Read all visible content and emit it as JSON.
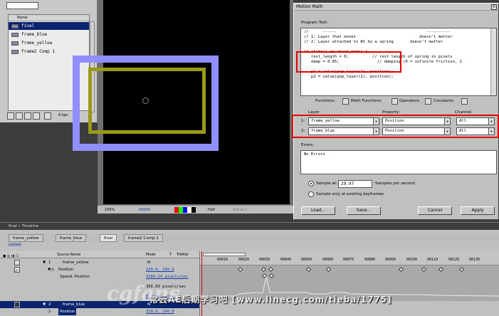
{
  "project": {
    "column_name": "Name",
    "items": [
      {
        "label": "final"
      },
      {
        "label": "frame_blue"
      },
      {
        "label": "frame_yellow"
      },
      {
        "label": "frame2 Comp 1"
      }
    ],
    "bpc": "8 bpc"
  },
  "viewer": {
    "zoom": "100%",
    "timecode": "00000",
    "resolution": "Half",
    "camera": "Active C..."
  },
  "dialog": {
    "title": "Motion Math",
    "program_text_label": "Program Text:",
    "code_lines": [
      "//      ------                                      ----------",
      "// 1: Layer that moves                           doesn't matter",
      "// 2: Layer attached to #1 by a spring       doesn't matter",
      "",
      "if (time() == start_time) {",
      "   rest_length = 0;          // rest length of spring in pixels",
      "   damp = 0.85;                // damping (0 = infinite friction, 1",
      "",
      "   p1 = value(pop_layer(1), position);",
      "   p2 = value(pop_layer(2), position);"
    ],
    "menus": {
      "functions": "Functions:",
      "math_functions": "Math Functions:",
      "operators": "Operators:",
      "constants": "Constants:"
    },
    "columns": {
      "layer": "Layer:",
      "property": "Property:",
      "channel": "Channel:"
    },
    "rows": [
      {
        "index": "1:",
        "layer": "frame_yellow",
        "property": "Position",
        "channel": "All"
      },
      {
        "index": "2:",
        "layer": "frame_blue",
        "property": "Position",
        "channel": "All"
      }
    ],
    "errors_label": "Errors:",
    "errors_text": "No Errors",
    "sample_at_label": "Sample at:",
    "sample_rate": "29.97",
    "samples_per_second": "Samples per second",
    "sample_keyframes": "Sample only at existing keyframes",
    "buttons": {
      "load": "Load...",
      "save": "Save...",
      "cancel": "Cancel",
      "apply": "Apply"
    }
  },
  "timeline": {
    "title": "final • Timeline",
    "tabs": [
      "frame_yellow",
      "frame_blue",
      "final",
      "frame2 Comp 1"
    ],
    "current_time": "00000",
    "columns": {
      "source_name": "Source Name",
      "mode": "Mode",
      "t": "T",
      "trkmat": "TrkMat"
    },
    "rows": {
      "layer1_index": "1",
      "layer1_name": "frame_yellow",
      "layer1_mode": "N",
      "position_label": "Position",
      "position_value": "320.0, 240.0",
      "speed_label": "Speed: Position",
      "speed_value": "3269.24 pixels/sec",
      "speed_max": "356.03 pixels/sec",
      "speed_min": "0.00 pixels/sec",
      "layer2_index": "2",
      "layer2_name": "frame_blue",
      "layer2_mode": "N",
      "position2_label": "Position",
      "position2_value": "320.0, 240.0"
    },
    "ruler_ticks": [
      "00010",
      "00020",
      "00030",
      "00040",
      "00050",
      "00060",
      "00070",
      "00080",
      "00090",
      "00100",
      "00110",
      "00120",
      "00130"
    ]
  },
  "watermark": {
    "line": "常云AE后期学习吧 [www.linecg.com/tieba/1775]",
    "big": "cgfans"
  },
  "colors": {
    "selection": "#0b2470",
    "highlight": "#e00000",
    "frame_blue": "#8f8fff",
    "frame_yellow": "#999a18"
  }
}
